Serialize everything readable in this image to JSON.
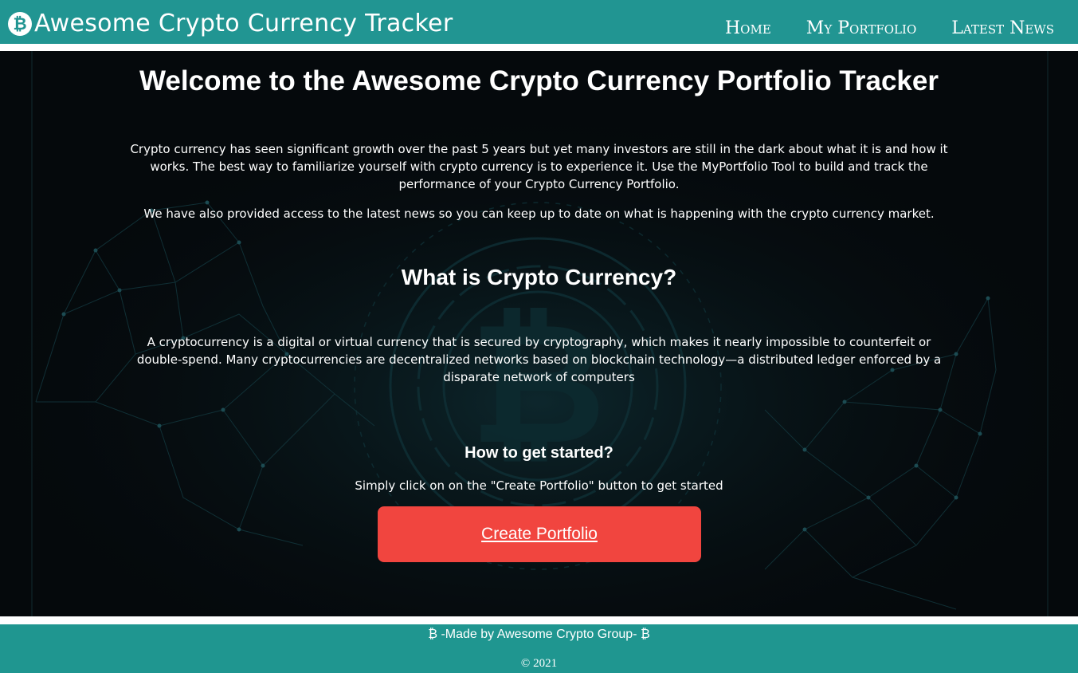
{
  "header": {
    "brand_icon": "₿",
    "title": "Awesome Crypto Currency Tracker",
    "nav": [
      "Home",
      "My Portfolio",
      "Latest News"
    ]
  },
  "main": {
    "heading": "Welcome to the Awesome Crypto Currency Portfolio Tracker",
    "intro": "Crypto currency has seen significant growth over the past 5 years but yet many investors are still in the dark about what it is and how it works. The best way to familiarize yourself with crypto currency is to experience it. Use the MyPortfolio Tool to build and track the performance of your Crypto Currency Portfolio.",
    "news_note": "We have also provided access to the latest news so you can keep up to date on what is happening with the crypto currency market.",
    "what_heading": "What is Crypto Currency?",
    "what_text": "A cryptocurrency is a digital or virtual currency that is secured by cryptography, which makes it nearly impossible to counterfeit or double-spend. Many cryptocurrencies are decentralized networks based on blockchain technology—a distributed ledger enforced by a disparate network of computers",
    "start_heading": "How to get started?",
    "start_text": "Simply click on on the \"Create Portfolio\" button to get started",
    "cta_label": "Create Portfolio"
  },
  "footer": {
    "made_by": "₿ -Made by Awesome Crypto Group- ₿",
    "copyright": "© 2021"
  },
  "colors": {
    "header": "#219592",
    "footer": "#1f9690",
    "hero_background": "#04080a",
    "cta": "#f1453f"
  }
}
